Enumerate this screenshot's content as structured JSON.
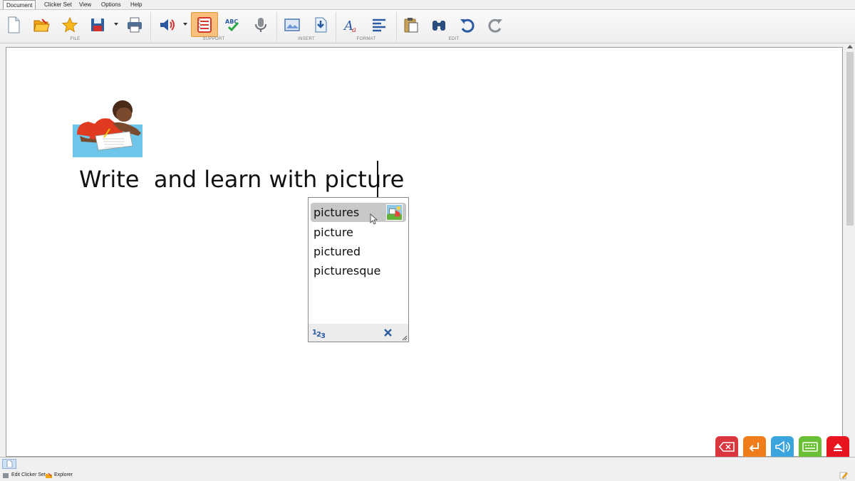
{
  "menu": {
    "tabs": [
      "Document",
      "Clicker Set",
      "View",
      "Options",
      "Help"
    ],
    "active_tab": "Document"
  },
  "ribbon": {
    "groups": {
      "file": "FILE",
      "support": "SUPPORT",
      "insert": "INSERT",
      "format": "FORMAT",
      "edit": "EDIT"
    },
    "buttons": [
      {
        "name": "new-document",
        "icon": "new-page-icon"
      },
      {
        "name": "open",
        "icon": "open-folder-icon"
      },
      {
        "name": "favourites",
        "icon": "star-icon"
      },
      {
        "name": "save",
        "icon": "floppy-disk-icon",
        "dropdown": true
      },
      {
        "name": "print",
        "icon": "printer-icon"
      },
      {
        "name": "speech",
        "icon": "speaker-icon",
        "dropdown": true
      },
      {
        "name": "word-predictor",
        "icon": "predictor-list-icon",
        "active": true
      },
      {
        "name": "spell-check",
        "icon": "abc-check-icon"
      },
      {
        "name": "voice-note",
        "icon": "microphone-icon"
      },
      {
        "name": "insert-picture",
        "icon": "image-icon"
      },
      {
        "name": "insert-clicker-picture",
        "icon": "picture-arrow-icon"
      },
      {
        "name": "font",
        "icon": "font-icon"
      },
      {
        "name": "alignment",
        "icon": "align-left-icon"
      },
      {
        "name": "paste",
        "icon": "clipboard-icon"
      },
      {
        "name": "find",
        "icon": "binoculars-icon"
      },
      {
        "name": "undo",
        "icon": "undo-icon"
      },
      {
        "name": "redo",
        "icon": "redo-icon"
      }
    ]
  },
  "document": {
    "text": "Write  and learn with picture"
  },
  "predictor": {
    "items": [
      "pictures",
      "picture",
      "pictured",
      "picturesque"
    ],
    "selected_index": 0
  },
  "colors": {
    "ribbon_active": "#f8c07c",
    "fab_delete": "#d9363e",
    "fab_enter": "#f07d1c",
    "fab_speak": "#3aa4dc",
    "fab_keyboard": "#6bbf35",
    "fab_hide": "#e8141f"
  },
  "statusbar": {
    "edit_clicker_set": "Edit Clicker Set",
    "explorer": "Explorer"
  }
}
